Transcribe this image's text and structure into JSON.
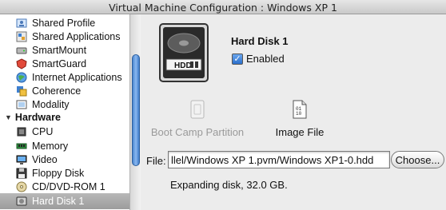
{
  "window": {
    "title": "Virtual Machine Configuration : Windows XP 1"
  },
  "sidebar": {
    "items": [
      {
        "label": "Shared Profile",
        "icon": "shared-profile-icon"
      },
      {
        "label": "Shared Applications",
        "icon": "shared-applications-icon"
      },
      {
        "label": "SmartMount",
        "icon": "smartmount-icon"
      },
      {
        "label": "SmartGuard",
        "icon": "smartguard-icon"
      },
      {
        "label": "Internet Applications",
        "icon": "internet-applications-icon"
      },
      {
        "label": "Coherence",
        "icon": "coherence-icon"
      },
      {
        "label": "Modality",
        "icon": "modality-icon"
      }
    ],
    "hardware_header": "Hardware",
    "hardware_items": [
      {
        "label": "CPU",
        "icon": "cpu-icon"
      },
      {
        "label": "Memory",
        "icon": "memory-icon"
      },
      {
        "label": "Video",
        "icon": "video-icon"
      },
      {
        "label": "Floppy Disk",
        "icon": "floppy-disk-icon"
      },
      {
        "label": "CD/DVD-ROM 1",
        "icon": "cd-dvd-icon"
      },
      {
        "label": "Hard Disk 1",
        "icon": "hard-disk-icon",
        "selected": true
      }
    ]
  },
  "main": {
    "hdd_label": "HDD",
    "title": "Hard Disk 1",
    "enabled_label": "Enabled",
    "enabled": true,
    "options": {
      "bootcamp_label": "Boot Camp Partition",
      "image_label": "Image File",
      "image_icon_text": "01\n10"
    },
    "file_label": "File:",
    "file_value": "llel/Windows XP 1.pvm/Windows XP1-0.hdd",
    "choose_label": "Choose...",
    "status": "Expanding disk, 32.0 GB."
  }
}
